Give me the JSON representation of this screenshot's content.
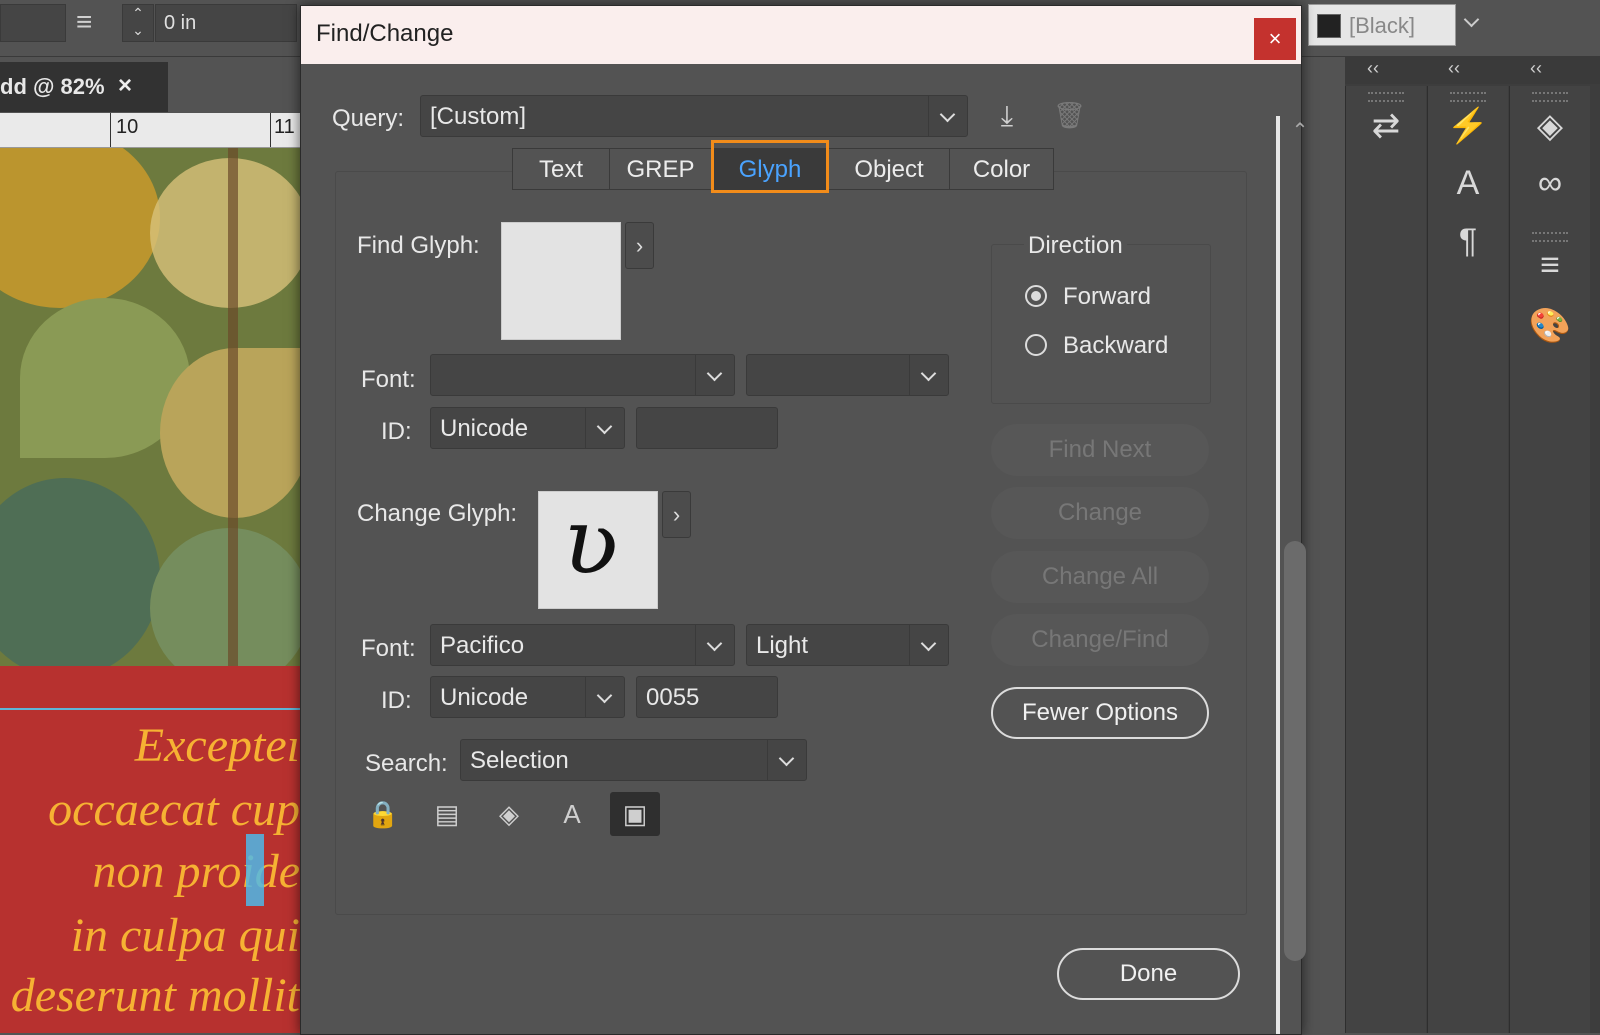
{
  "app": {
    "spacing_value": "0 in",
    "swatch_label": "[Black]",
    "doc_tab_label": "dd @ 82%",
    "ruler_labels": [
      "10",
      "11"
    ]
  },
  "document": {
    "lines": [
      "Excepteı",
      "occaecat cup",
      "non proide",
      "in culpa qui",
      "deserunt mollit"
    ],
    "highlight_char": "e",
    "highlight_color": "#4fb8e8",
    "text_color": "#f6b233",
    "page_color": "#b7312f"
  },
  "dialog": {
    "title": "Find/Change",
    "close_symbol": "×",
    "query_label": "Query:",
    "query_value": "[Custom]",
    "tabs": [
      {
        "label": "Text",
        "selected": false
      },
      {
        "label": "GREP",
        "selected": false
      },
      {
        "label": "Glyph",
        "selected": true
      },
      {
        "label": "Object",
        "selected": false
      },
      {
        "label": "Color",
        "selected": false
      }
    ],
    "find": {
      "label": "Find Glyph:",
      "font_label": "Font:",
      "font_family": "",
      "font_style": "",
      "id_label": "ID:",
      "id_type": "Unicode",
      "id_value": ""
    },
    "change": {
      "label": "Change Glyph:",
      "glyph_char": "ʋ",
      "font_label": "Font:",
      "font_family": "Pacifico",
      "font_style": "Light",
      "id_label": "ID:",
      "id_type": "Unicode",
      "id_value": "0055"
    },
    "search_label": "Search:",
    "search_value": "Selection",
    "direction": {
      "title": "Direction",
      "options": [
        {
          "label": "Forward",
          "selected": true
        },
        {
          "label": "Backward",
          "selected": false
        }
      ]
    },
    "buttons": {
      "find_next": "Find Next",
      "change": "Change",
      "change_all": "Change All",
      "change_find": "Change/Find",
      "fewer_options": "Fewer Options",
      "done": "Done"
    },
    "highlight_color": "#f28c1a"
  }
}
